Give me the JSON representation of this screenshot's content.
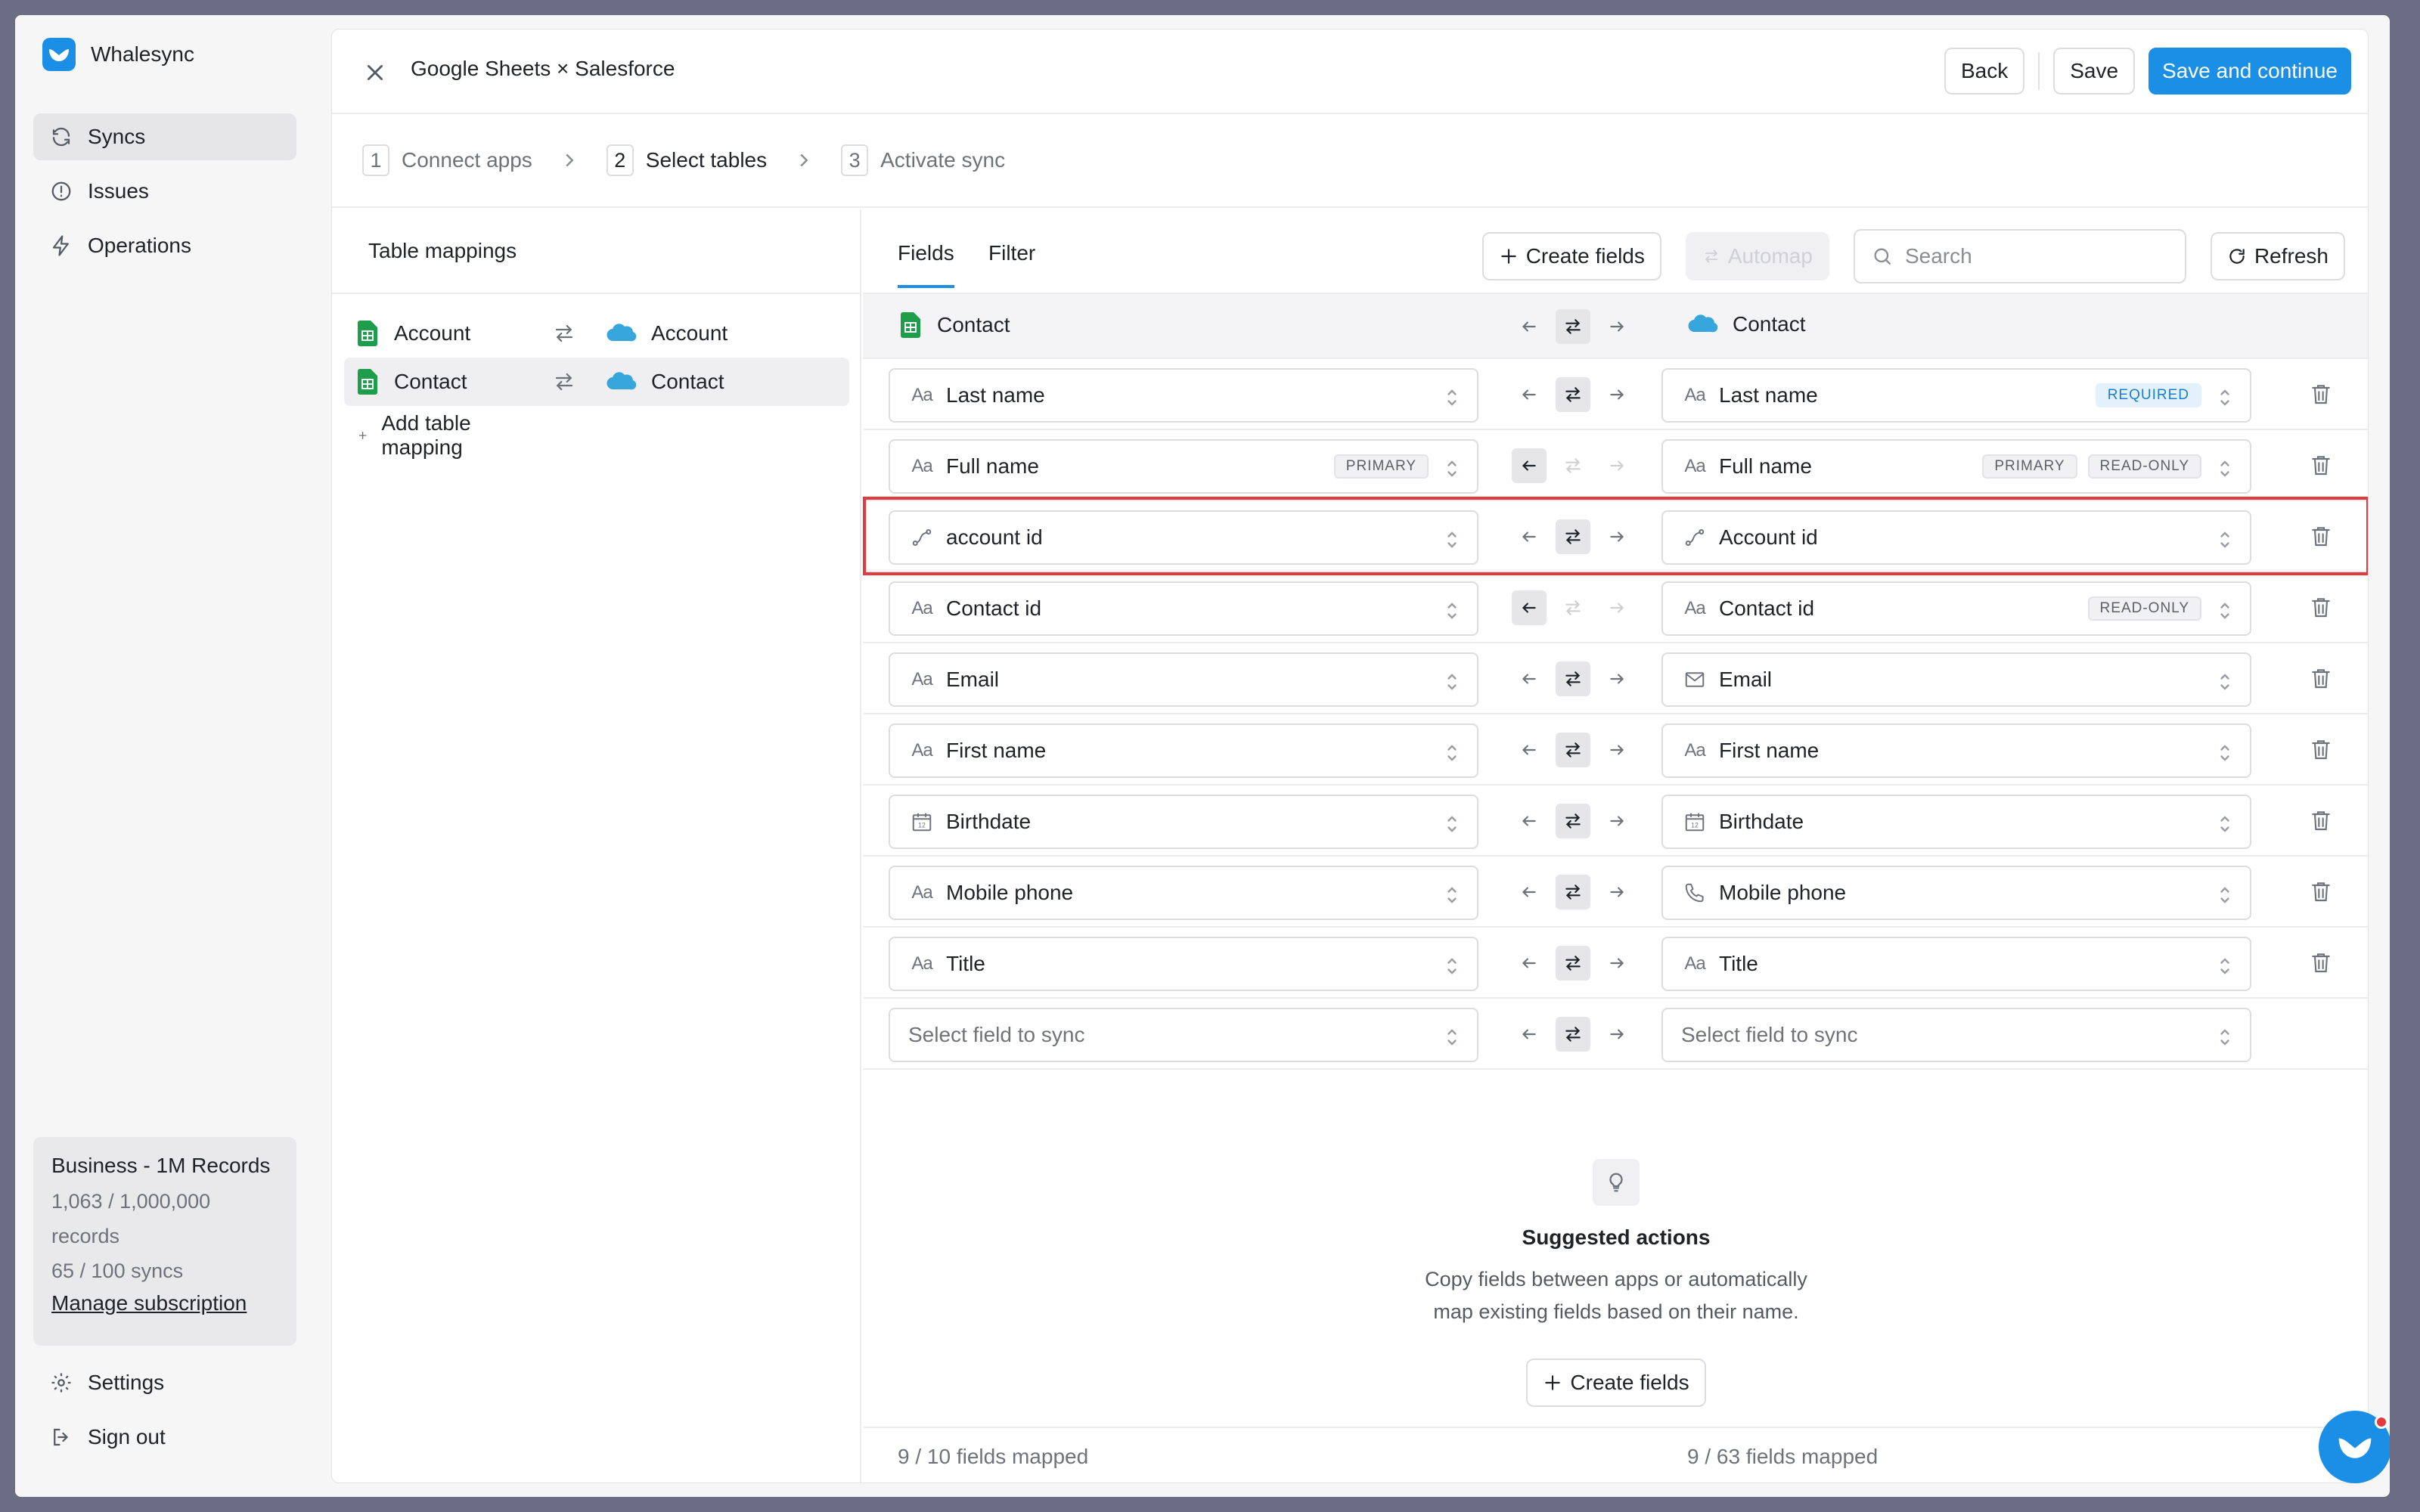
{
  "brand": {
    "name": "Whalesync"
  },
  "sidebar": {
    "items": [
      {
        "label": "Syncs",
        "icon": "refresh-icon",
        "active": true
      },
      {
        "label": "Issues",
        "icon": "alert-circle-icon"
      },
      {
        "label": "Operations",
        "icon": "bolt-icon"
      }
    ],
    "bottom": [
      {
        "label": "Settings",
        "icon": "gear-icon"
      },
      {
        "label": "Sign out",
        "icon": "sign-out-icon"
      }
    ]
  },
  "plan": {
    "title": "Business - 1M Records",
    "records_line1": "1,063 / 1,000,000",
    "records_line2": "records",
    "syncs": "65 / 100 syncs",
    "manage": "Manage subscription"
  },
  "header": {
    "title": "Google Sheets × Salesforce",
    "back": "Back",
    "save": "Save",
    "save_continue": "Save and continue"
  },
  "steps": [
    {
      "num": "1",
      "label": "Connect apps"
    },
    {
      "num": "2",
      "label": "Select tables",
      "active": true
    },
    {
      "num": "3",
      "label": "Activate sync"
    }
  ],
  "mappings": {
    "title": "Table mappings",
    "rows": [
      {
        "left": "Account",
        "right": "Account"
      },
      {
        "left": "Contact",
        "right": "Contact",
        "active": true
      }
    ],
    "add": "Add table mapping"
  },
  "fields_panel": {
    "tabs": [
      "Fields",
      "Filter"
    ],
    "create_fields": "Create fields",
    "automap": "Automap",
    "search_placeholder": "Search",
    "refresh": "Refresh",
    "left_table": "Contact",
    "right_table": "Contact",
    "rows": [
      {
        "left": "Last name",
        "left_icon": "text-icon",
        "right": "Last name",
        "right_icon": "text-icon",
        "right_badges": [
          "REQUIRED"
        ],
        "direction": "both"
      },
      {
        "left": "Full name",
        "left_icon": "text-icon",
        "left_badges": [
          "PRIMARY"
        ],
        "right": "Full name",
        "right_icon": "text-icon",
        "right_badges": [
          "PRIMARY",
          "READ-ONLY"
        ],
        "direction": "left"
      },
      {
        "left": "account id",
        "left_icon": "link-icon",
        "right": "Account id",
        "right_icon": "link-icon",
        "direction": "both",
        "highlighted": true
      },
      {
        "left": "Contact id",
        "left_icon": "text-icon",
        "right": "Contact id",
        "right_icon": "text-icon",
        "right_badges": [
          "READ-ONLY"
        ],
        "direction": "left"
      },
      {
        "left": "Email",
        "left_icon": "text-icon",
        "right": "Email",
        "right_icon": "mail-icon",
        "direction": "both"
      },
      {
        "left": "First name",
        "left_icon": "text-icon",
        "right": "First name",
        "right_icon": "text-icon",
        "direction": "both"
      },
      {
        "left": "Birthdate",
        "left_icon": "calendar-icon",
        "right": "Birthdate",
        "right_icon": "calendar-icon",
        "direction": "both"
      },
      {
        "left": "Mobile phone",
        "left_icon": "text-icon",
        "right": "Mobile phone",
        "right_icon": "phone-icon",
        "direction": "both"
      },
      {
        "left": "Title",
        "left_icon": "text-icon",
        "right": "Title",
        "right_icon": "text-icon",
        "direction": "both"
      }
    ],
    "empty_row_placeholder": "Select field to sync",
    "suggested": {
      "title": "Suggested actions",
      "line1": "Copy fields between apps or automatically",
      "line2": "map existing fields based on their name.",
      "button": "Create fields"
    },
    "footer_left": "9 / 10 fields mapped",
    "footer_right": "9 / 63 fields mapped"
  },
  "colors": {
    "accent": "#1b8fe6",
    "highlight": "#e23a3f",
    "sheets_green": "#1e9e4a",
    "salesforce_blue": "#37a6dd"
  }
}
